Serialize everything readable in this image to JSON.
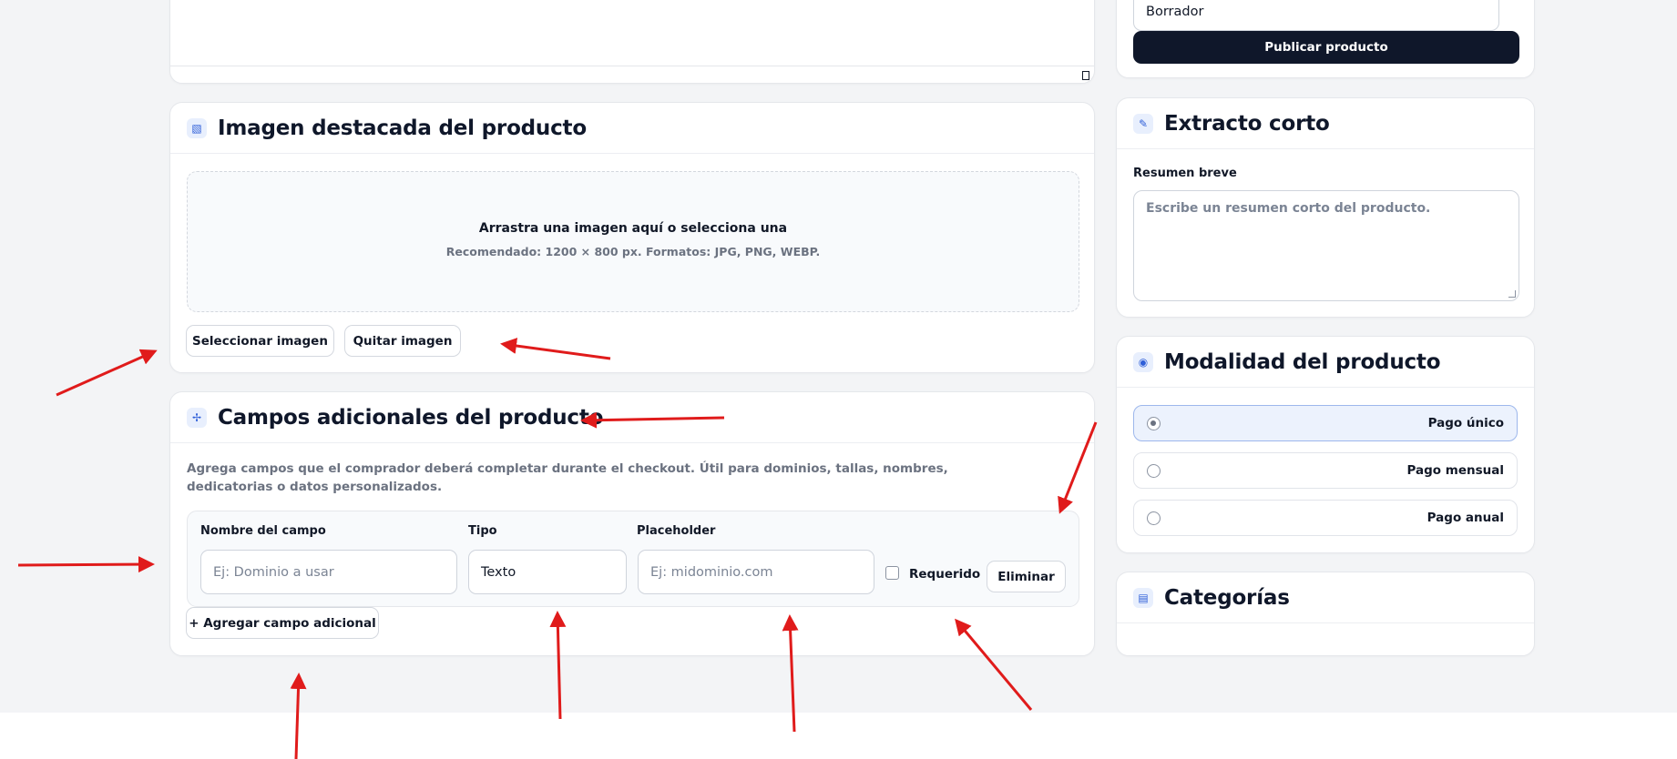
{
  "publish": {
    "status_value": "Borrador",
    "publish_button": "Publicar producto"
  },
  "featured_image": {
    "title": "Imagen destacada del producto",
    "icon": "image-icon",
    "drop_title": "Arrastra una imagen aquí o selecciona una",
    "drop_hint": "Recomendado: 1200 × 800 px. Formatos: JPG, PNG, WEBP.",
    "select_button": "Seleccionar imagen",
    "remove_button": "Quitar imagen"
  },
  "custom_fields": {
    "title": "Campos adicionales del producto",
    "icon": "move-icon",
    "description": "Agrega campos que el comprador deberá completar durante el checkout. Útil para dominios, tallas, nombres, dedicatorias o datos personalizados.",
    "col_name": "Nombre del campo",
    "col_type": "Tipo",
    "col_placeholder": "Placeholder",
    "name_placeholder": "Ej: Dominio a usar",
    "type_value": "Texto",
    "placeholder_placeholder": "Ej: midominio.com",
    "required_label": "Requerido",
    "required_checked": false,
    "delete_button": "Eliminar",
    "add_button": "+ Agregar campo adicional"
  },
  "excerpt": {
    "title": "Extracto corto",
    "icon": "pencil-icon",
    "label": "Resumen breve",
    "placeholder": "Escribe un resumen corto del producto."
  },
  "modality": {
    "title": "Modalidad del producto",
    "icon": "radio-icon",
    "options": [
      {
        "label": "Pago único",
        "selected": true
      },
      {
        "label": "Pago mensual",
        "selected": false
      },
      {
        "label": "Pago anual",
        "selected": false
      }
    ]
  },
  "categories": {
    "title": "Categorías",
    "icon": "list-icon"
  },
  "colors": {
    "accent_dark": "#0f172a",
    "accent_blue": "#2f5fd8",
    "annotation_arrow": "#e01b1b"
  }
}
